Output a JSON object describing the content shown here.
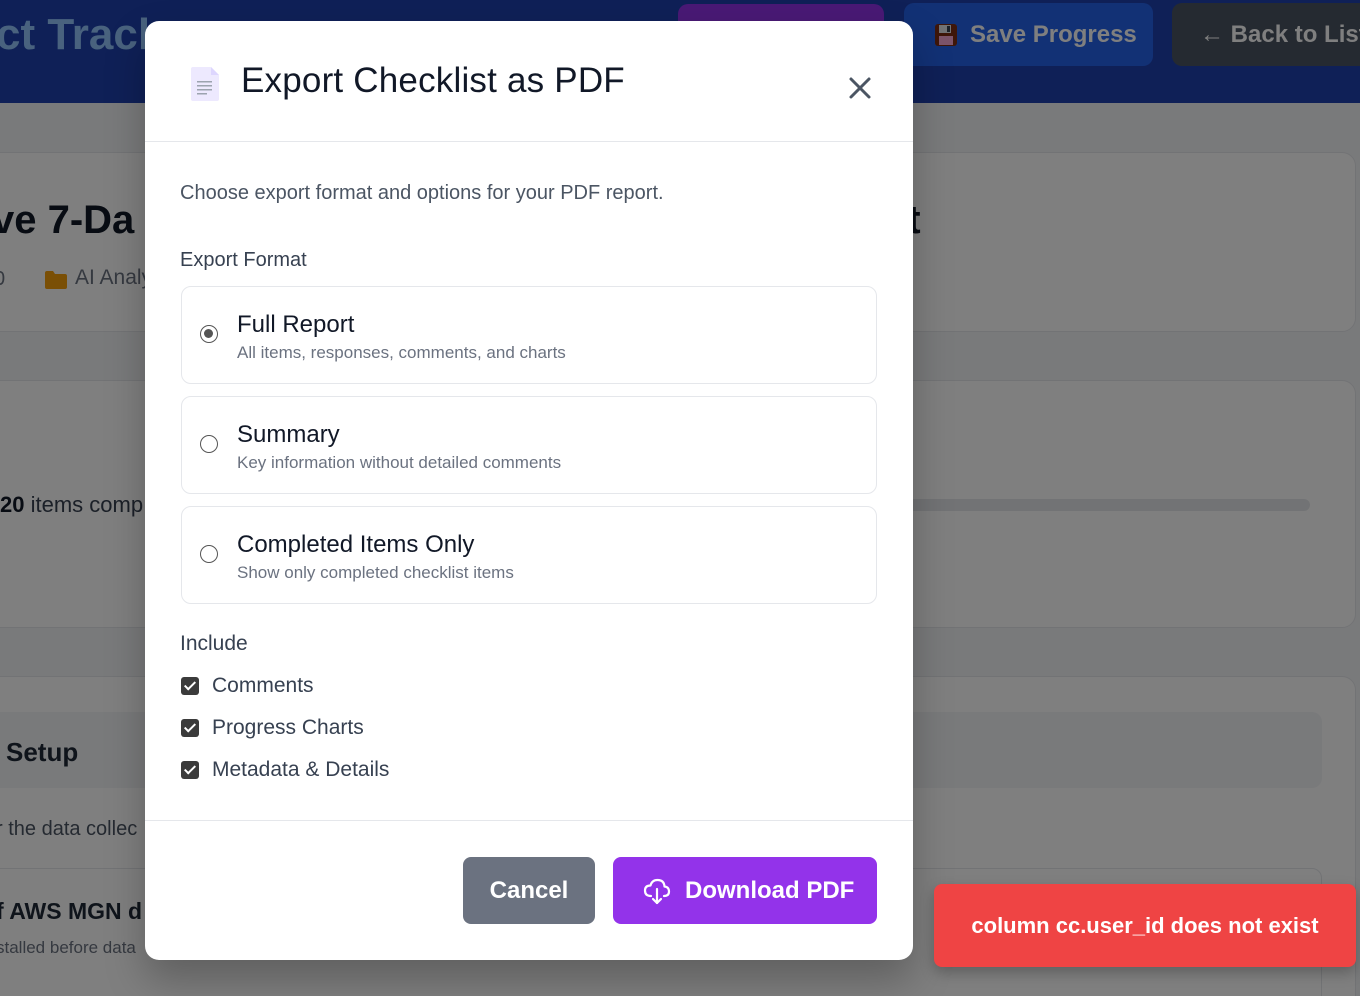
{
  "header": {
    "app_title": "ct Track",
    "save_label": "Save Progress",
    "back_label": "← Back to List"
  },
  "background": {
    "checklist_title_start": "ve 7-Da",
    "checklist_title_end": "st",
    "meta_number": "0",
    "meta_category": "AI Analy",
    "progress_count": "20",
    "progress_suffix": " items comp",
    "section_title": "Setup",
    "section_description": "r the data collec",
    "item_title": "f AWS MGN d",
    "item_description": "stalled before data"
  },
  "modal": {
    "title": "Export Checklist as PDF",
    "intro": "Choose export format and options for your PDF report.",
    "format_heading": "Export Format",
    "formats": [
      {
        "title": "Full Report",
        "description": "All items, responses, comments, and charts",
        "selected": true
      },
      {
        "title": "Summary",
        "description": "Key information without detailed comments",
        "selected": false
      },
      {
        "title": "Completed Items Only",
        "description": "Show only completed checklist items",
        "selected": false
      }
    ],
    "include_heading": "Include",
    "include_options": [
      {
        "label": "Comments",
        "checked": true
      },
      {
        "label": "Progress Charts",
        "checked": true
      },
      {
        "label": "Metadata & Details",
        "checked": true
      }
    ],
    "cancel_label": "Cancel",
    "download_label": "Download PDF"
  },
  "toast": {
    "message": "column cc.user_id does not exist"
  },
  "icons": {
    "document": "document-icon",
    "close": "close-icon",
    "cloud_download": "cloud-download-icon",
    "floppy": "floppy-disk-icon",
    "folder": "folder-icon"
  },
  "colors": {
    "topbar": "#1e40af",
    "primary_purple": "#9333ea",
    "save_blue": "#2563eb",
    "neutral_gray": "#6b7280",
    "error_red": "#ef4444"
  }
}
